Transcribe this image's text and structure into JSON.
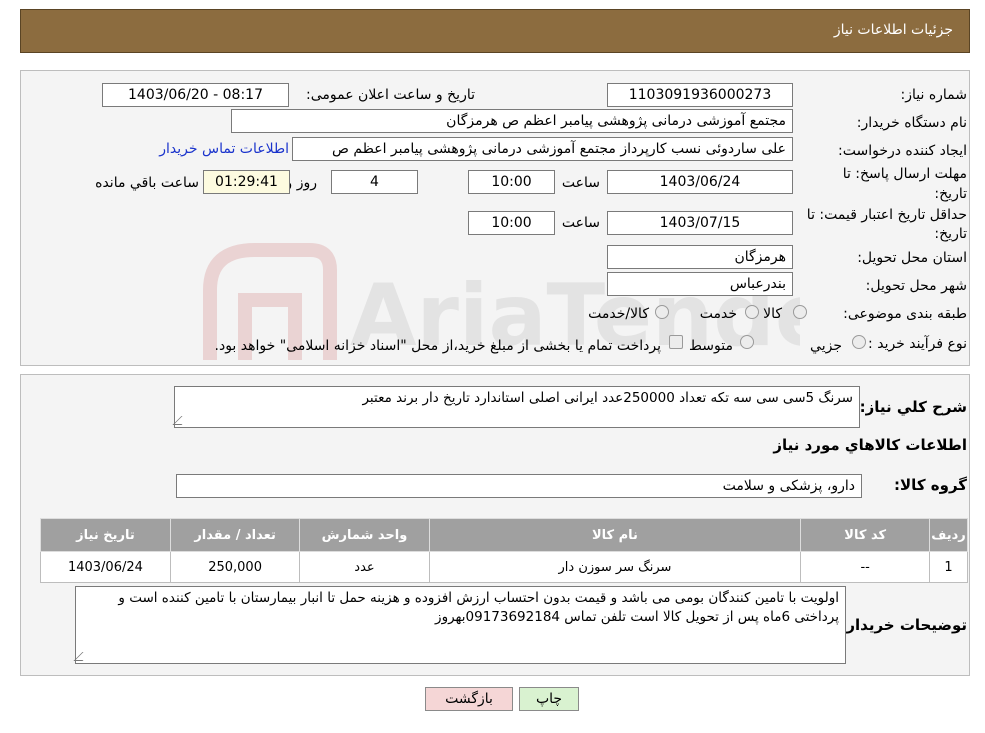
{
  "header": {
    "title": "جزئیات اطلاعات نیاز"
  },
  "form": {
    "need_number_label": "شماره نیاز:",
    "need_number": "1103091936000273",
    "announce_label": "تاریخ و ساعت اعلان عمومی:",
    "announce_value": "1403/06/20 - 08:17",
    "buyer_org_label": "نام دستگاه خریدار:",
    "buyer_org": "مجتمع آموزشی درمانی پژوهشی پیامبر اعظم ص  هرمزگان",
    "creator_label": "ایجاد کننده درخواست:",
    "creator": "علی ساردوئی نسب کارپرداز مجتمع آموزشی درمانی پژوهشی پیامبر اعظم ص",
    "contact_link": "اطلاعات تماس خریدار",
    "deadline_label_1": "مهلت ارسال پاسخ: تا",
    "deadline_label_2": "تاریخ:",
    "deadline_date": "1403/06/24",
    "time_word": "ساعت",
    "deadline_time": "10:00",
    "days_value": "4",
    "days_label": "روز و",
    "remaining_time": "01:29:41",
    "remaining_label": "ساعت باقي مانده",
    "validity_label_1": "حداقل تاریخ اعتبار قیمت: تا",
    "validity_label_2": "تاریخ:",
    "validity_date": "1403/07/15",
    "validity_time": "10:00",
    "province_label": "استان محل تحویل:",
    "province": "هرمزگان",
    "city_label": "شهر محل تحویل:",
    "city": "بندرعباس",
    "category_label": "طبقه بندی موضوعی:",
    "category_options": [
      "کالا",
      "خدمت",
      "کالا/خدمت"
    ],
    "process_label": "نوع فرآیند خرید :",
    "process_options": [
      "جزیي",
      "متوسط"
    ],
    "process_note": "پرداخت تمام یا بخشی از مبلغ خرید،از محل \"اسناد خزانه اسلامی\" خواهد بود."
  },
  "details": {
    "summary_label": "شرح کلي نياز:",
    "summary": "سرنگ 5سی سی  سه تکه  تعداد 250000عدد ایرانی اصلی استاندارد تاریخ دار برند معتبر",
    "goods_info_title": "اطلاعات کالاهاي مورد نياز",
    "goods_group_label": "گروه کالا:",
    "goods_group": "دارو، پزشکی و سلامت",
    "table": {
      "headers": [
        "رديف",
        "کد کالا",
        "نام کالا",
        "واحد شمارش",
        "تعداد / مقدار",
        "تاريخ نياز"
      ],
      "rows": [
        [
          "1",
          "--",
          "سرنگ سر سوزن دار",
          "عدد",
          "250,000",
          "1403/06/24"
        ]
      ]
    },
    "buyer_notes_label": "توضیحات خریدار:",
    "buyer_notes": "اولویت با تامین کنندگان بومی می باشد و قیمت بدون احتساب ارزش افزوده و هزینه حمل تا انبار بیمارستان با تامین کننده است و پرداختی 6ماه پس از تحویل کالا است تلفن تماس 09173692184بهروز"
  },
  "buttons": {
    "print": "چاپ",
    "back": "بازگشت"
  },
  "watermark_text": "AriaTender.neT",
  "colors": {
    "header_bg": "#8c6c3f",
    "link": "#1a33cc",
    "print_btn": "#d9f2d0",
    "back_btn": "#f5d6d6"
  }
}
